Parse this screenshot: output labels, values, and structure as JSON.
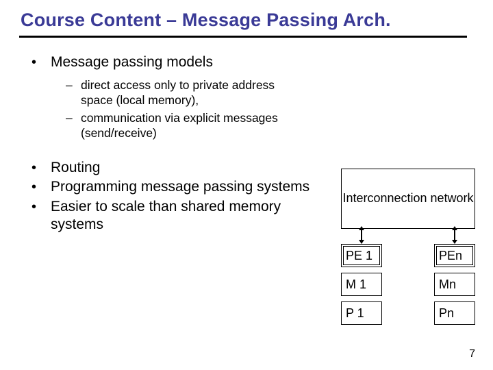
{
  "title": "Course Content – Message Passing Arch.",
  "bullets": {
    "main1": "Message passing models",
    "sub1": "direct access only to private address space (local memory),",
    "sub2": "communication via explicit messages (send/receive)",
    "main2": "Routing",
    "main3": "Programming message passing systems",
    "main4": "Easier to scale than shared memory systems"
  },
  "diagram": {
    "network": "Interconnection network",
    "left": {
      "pe": "PE 1",
      "m": "M 1",
      "p": "P 1"
    },
    "right": {
      "pe": "PEn",
      "m": "Mn",
      "p": "Pn"
    }
  },
  "page": "7"
}
